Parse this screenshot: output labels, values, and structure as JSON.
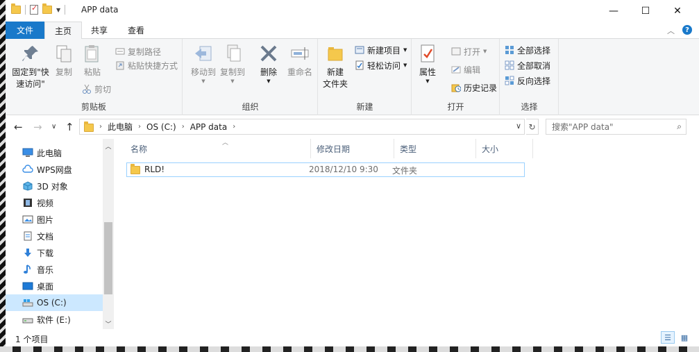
{
  "window": {
    "title": "APP data",
    "controls": {
      "minimize": "—",
      "maximize": "☐",
      "close": "✕"
    }
  },
  "ribbon_tabs": {
    "file": "文件",
    "home": "主页",
    "share": "共享",
    "view": "查看"
  },
  "ribbon": {
    "clipboard": {
      "label": "剪贴板",
      "pin_line1": "固定到\"快",
      "pin_line2": "速访问\"",
      "copy": "复制",
      "paste": "粘贴",
      "copy_path": "复制路径",
      "paste_shortcut": "粘贴快捷方式",
      "cut": "剪切"
    },
    "organize": {
      "label": "组织",
      "move_to": "移动到",
      "copy_to": "复制到",
      "delete": "删除",
      "rename": "重命名"
    },
    "new": {
      "label": "新建",
      "new_folder_line1": "新建",
      "new_folder_line2": "文件夹",
      "new_item": "新建项目",
      "easy_access": "轻松访问"
    },
    "open": {
      "label": "打开",
      "properties": "属性",
      "open": "打开",
      "edit": "编辑",
      "history": "历史记录"
    },
    "select": {
      "label": "选择",
      "select_all": "全部选择",
      "select_none": "全部取消",
      "invert": "反向选择"
    }
  },
  "address": {
    "crumbs": [
      "此电脑",
      "OS (C:)",
      "APP data"
    ],
    "search_placeholder": "搜索\"APP data\""
  },
  "nav_pane": {
    "items": [
      {
        "label": "此电脑",
        "icon": "monitor-icon"
      },
      {
        "label": "WPS网盘",
        "icon": "cloud-icon"
      },
      {
        "label": "3D 对象",
        "icon": "cube-icon"
      },
      {
        "label": "视频",
        "icon": "film-icon"
      },
      {
        "label": "图片",
        "icon": "picture-icon"
      },
      {
        "label": "文档",
        "icon": "document-icon"
      },
      {
        "label": "下载",
        "icon": "download-arrow-icon"
      },
      {
        "label": "音乐",
        "icon": "music-note-icon"
      },
      {
        "label": "桌面",
        "icon": "desktop-icon"
      },
      {
        "label": "OS (C:)",
        "icon": "drive-icon"
      },
      {
        "label": "软件 (E:)",
        "icon": "drive-icon"
      }
    ],
    "selected": "OS (C:)"
  },
  "file_list": {
    "columns": [
      "名称",
      "修改日期",
      "类型",
      "大小"
    ],
    "rows": [
      {
        "name": "RLD!",
        "modified": "2018/12/10 9:30",
        "type": "文件夹",
        "size": ""
      }
    ]
  },
  "status_bar": {
    "item_count": "1 个项目"
  },
  "colors": {
    "accent": "#1979ca",
    "selection": "#cce8ff",
    "folder": "#f5c84c"
  }
}
